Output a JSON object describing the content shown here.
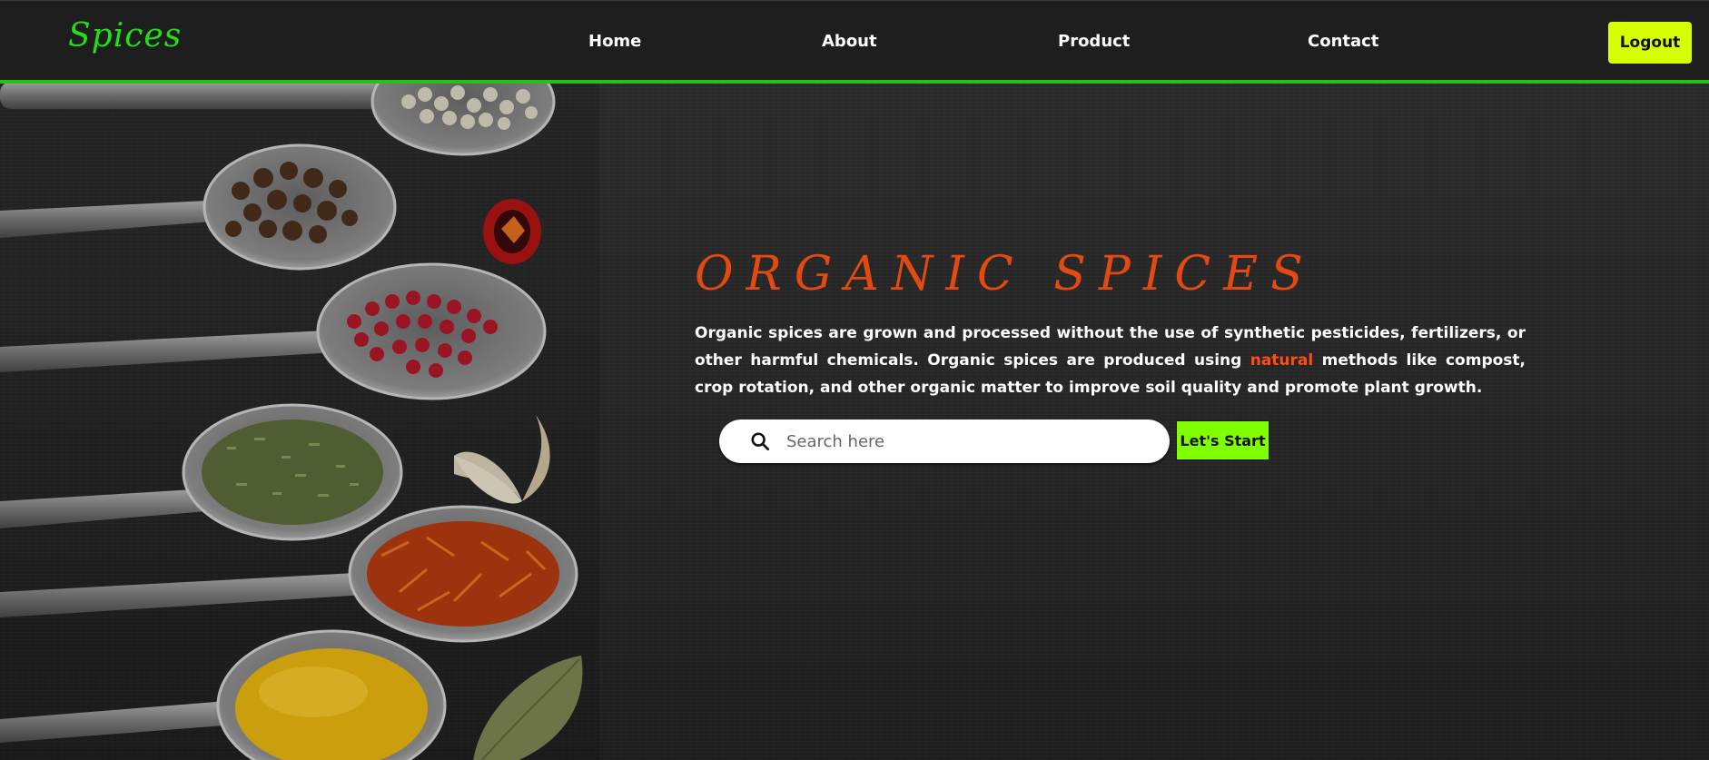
{
  "brand": {
    "logo_text": "Spices",
    "accent": "#22e016"
  },
  "nav": {
    "items": [
      {
        "label": "Home"
      },
      {
        "label": "About"
      },
      {
        "label": "Product"
      },
      {
        "label": "Contact"
      }
    ],
    "logout_label": "Logout"
  },
  "hero": {
    "title": "ORGANIC SPICES",
    "paragraph_before": "Organic spices are grown and processed without the use of synthetic pesticides, fertilizers, or other harmful chemicals. Organic spices are produced using ",
    "paragraph_highlight": "natural",
    "paragraph_after": " methods like compost, crop rotation, and other organic matter to improve soil quality and promote plant growth.",
    "search_placeholder": "Search here",
    "cta_label": "Let's Start",
    "icons": {
      "search": "search-icon"
    }
  },
  "colors": {
    "nav_bg": "#1e1e1e",
    "nav_border": "#22c414",
    "logout_bg": "#d6ff00",
    "cta_bg": "#7fff00",
    "title": "#e34a12",
    "highlight": "#ff4d1a"
  }
}
